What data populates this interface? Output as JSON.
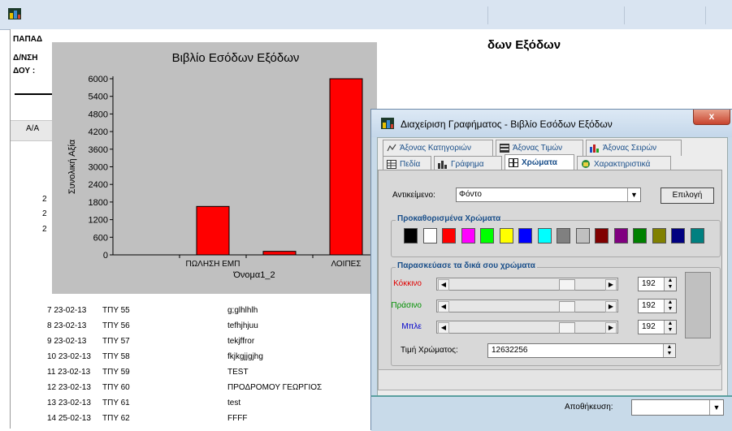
{
  "report": {
    "header_line1": "ΠΑΠΑΔ",
    "header_line2": "Δ/ΝΣΗ",
    "header_line3": "ΔΟΥ :",
    "title": "δων Εξόδων",
    "column_aa": "Α/Α",
    "side_numbers": [
      "2",
      "2",
      "2"
    ],
    "rows": [
      {
        "no": "7 23-02-13",
        "code": "ΤΠΥ 55",
        "desc": "g;glhlhlh"
      },
      {
        "no": "8 23-02-13",
        "code": "ΤΠΥ 56",
        "desc": "tefhjhjuu"
      },
      {
        "no": "9 23-02-13",
        "code": "ΤΠΥ 57",
        "desc": "tekjffror"
      },
      {
        "no": "10 23-02-13",
        "code": "ΤΠΥ 58",
        "desc": "fkjkgjjgjhg"
      },
      {
        "no": "11 23-02-13",
        "code": "ΤΠΥ 59",
        "desc": "TEST"
      },
      {
        "no": "12 23-02-13",
        "code": "ΤΠΥ 60",
        "desc": "ΠΡΟΔΡΟΜΟΥ ΓΕΩΡΓΙΟΣ"
      },
      {
        "no": "13 23-02-13",
        "code": "ΤΠΥ 61",
        "desc": "test"
      },
      {
        "no": "14 25-02-13",
        "code": "ΤΠΥ 62",
        "desc": "FFFF"
      }
    ]
  },
  "chart_data": {
    "type": "bar",
    "title": "Βιβλίο Εσόδων Εξόδων",
    "ylabel": "Συνολική Αξία",
    "xlabel": "Όνομα1_2",
    "ylim": [
      0,
      6000
    ],
    "yticks": [
      0,
      600,
      1200,
      1800,
      2400,
      3000,
      3600,
      4200,
      4800,
      5400,
      6000
    ],
    "categories": [
      "",
      "ΠΩΛΗΣΗ ΕΜΠ",
      "",
      "ΛΟΙΠΕΣ"
    ],
    "values": [
      0,
      1650,
      120,
      6000
    ],
    "bar_color": "#ff0000",
    "background": "#c0c0c0"
  },
  "dialog": {
    "title": "Διαχείριση Γραφήματος - Βιβλίο Εσόδων Εξόδων",
    "close": "x",
    "tabs_row1": [
      {
        "label": "Άξονας Κατηγοριών",
        "icon": "category-axis-icon"
      },
      {
        "label": "Άξονας Τιμών",
        "icon": "value-axis-icon"
      },
      {
        "label": "Άξονας Σειρών",
        "icon": "series-axis-icon"
      }
    ],
    "tabs_row2": [
      {
        "label": "Πεδία",
        "icon": "fields-icon"
      },
      {
        "label": "Γράφημα",
        "icon": "chart-icon"
      },
      {
        "label": "Χρώματα",
        "icon": "colors-icon"
      },
      {
        "label": "Χαρακτηριστικά",
        "icon": "properties-icon"
      }
    ],
    "active_tab": "Χρώματα",
    "object_label": "Αντικείμενο:",
    "object_value": "Φόντο",
    "choose_button": "Επιλογή",
    "predefined_legend": "Προκαθορισμένα Χρώματα",
    "swatches": [
      "#000000",
      "#ffffff",
      "#ff0000",
      "#ff00ff",
      "#00ff00",
      "#ffff00",
      "#0000ff",
      "#00ffff",
      "#808080",
      "#c0c0c0",
      "#800000",
      "#800080",
      "#008000",
      "#808000",
      "#000080",
      "#008080"
    ],
    "custom_legend": "Παρασκεύασε τα δικά σου χρώματα",
    "red_label": "Κόκκινο",
    "green_label": "Πράσινο",
    "blue_label": "Μπλε",
    "red_value": "192",
    "green_value": "192",
    "blue_value": "192",
    "red_color": "#e00000",
    "green_color": "#009000",
    "blue_color": "#0000cc",
    "color_value_label": "Τιμή Χρώματος:",
    "color_value": "12632256",
    "save_label": "Αποθήκευση:",
    "save_value": ""
  }
}
